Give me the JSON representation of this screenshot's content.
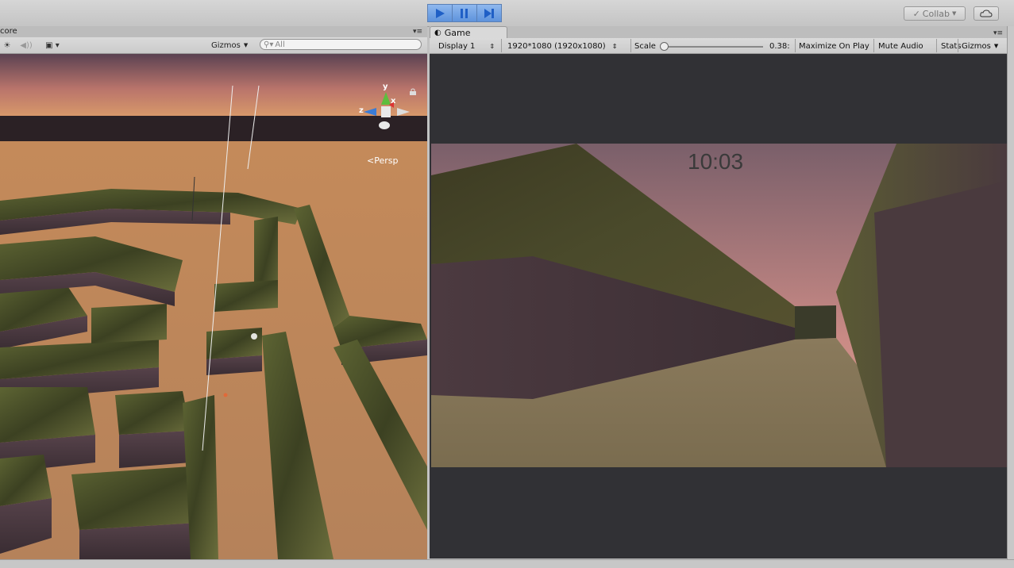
{
  "toolbar": {
    "play_label": "Play",
    "pause_label": "Pause",
    "step_label": "Step",
    "collab_label": "Collab",
    "accent": "#3a78d6"
  },
  "scene": {
    "tab_label": "core",
    "gizmos_label": "Gizmos",
    "search_placeholder": "All",
    "persp_label": "Persp",
    "axis_y": "y",
    "axis_x": "x",
    "axis_z": "z"
  },
  "game": {
    "tab_label": "Game",
    "display_label": "Display 1",
    "resolution_label": "1920*1080 (1920x1080)",
    "scale_label": "Scale",
    "scale_value": "0.38:",
    "maximize_label": "Maximize On Play",
    "mute_label": "Mute Audio",
    "stats_label": "Stats",
    "gizmos_label": "Gizmos",
    "timer_text": "10:03"
  }
}
